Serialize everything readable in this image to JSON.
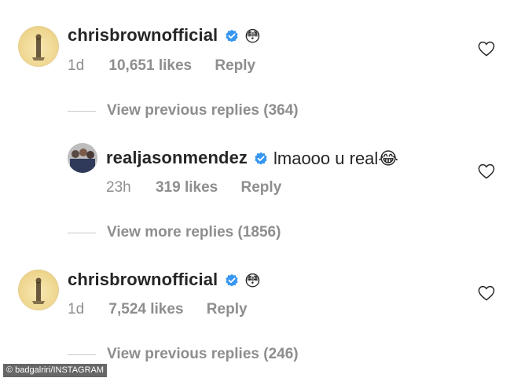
{
  "comments": [
    {
      "username": "chrisbrownofficial",
      "verified": true,
      "text": "😳",
      "time": "1d",
      "likes": "10,651 likes",
      "reply": "Reply"
    },
    {
      "username": "realjasonmendez",
      "verified": true,
      "text": "lmaooo u real😂",
      "time": "23h",
      "likes": "319 likes",
      "reply": "Reply"
    },
    {
      "username": "chrisbrownofficial",
      "verified": true,
      "text": "😳",
      "time": "1d",
      "likes": "7,524 likes",
      "reply": "Reply"
    }
  ],
  "view_replies": [
    "View previous replies (364)",
    "View more replies (1856)",
    "View previous replies (246)"
  ],
  "watermark": "© badgalriri/INSTAGRAM",
  "colors": {
    "text": "#262626",
    "muted": "#8e8e8e",
    "verified_blue": "#3897f0",
    "divider": "#c7c7c7"
  },
  "icons": {
    "like": "heart-outline-icon",
    "verified": "verified-badge-icon"
  }
}
